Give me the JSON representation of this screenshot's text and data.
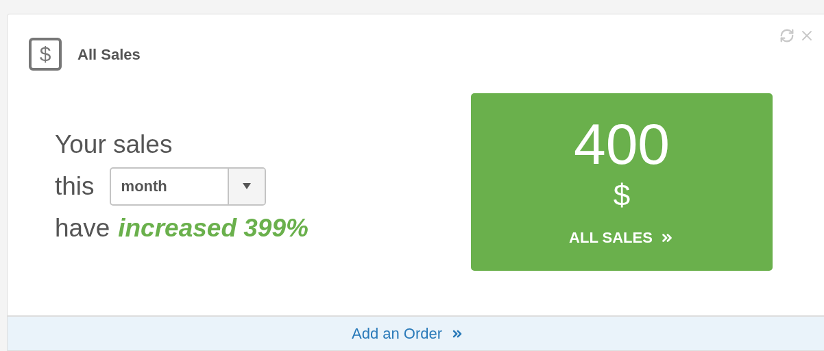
{
  "widget": {
    "icon": "$",
    "title": "All Sales"
  },
  "summary": {
    "line_1": "Your sales",
    "line_2_prefix": "this",
    "period_select": {
      "value": "month"
    },
    "line_3_prefix": "have",
    "change": "increased 399%"
  },
  "total_card": {
    "value": "400",
    "unit": "$",
    "link": "ALL SALES"
  },
  "footer_link": "Add an Order"
}
